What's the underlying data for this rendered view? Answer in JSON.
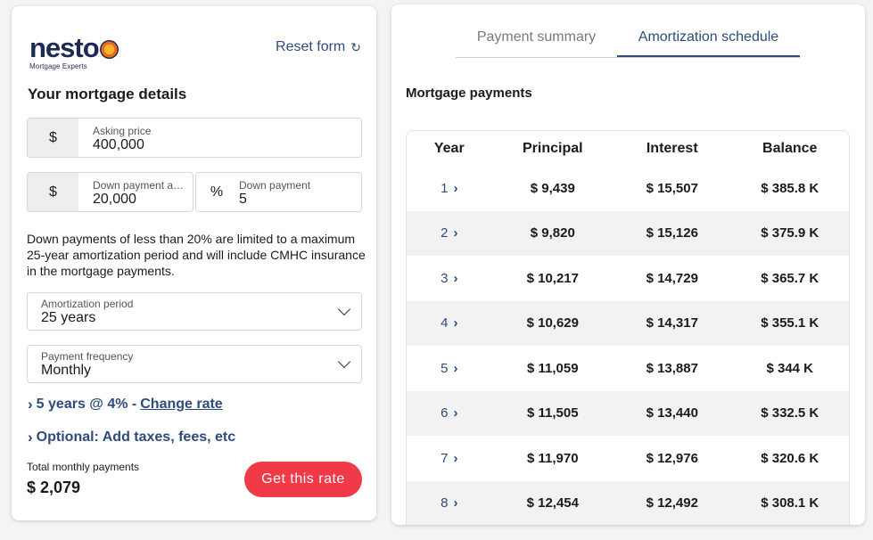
{
  "brand": {
    "name": "nesto",
    "tagline": "Mortgage Experts",
    "accent": "#2f4b7c",
    "cta_color": "#f03a47"
  },
  "form": {
    "reset_label": "Reset form",
    "title": "Your mortgage details",
    "asking_price": {
      "prefix": "$",
      "label": "Asking price",
      "value": "400,000"
    },
    "down_payment_amount": {
      "prefix": "$",
      "label": "Down payment amount",
      "value": "20,000"
    },
    "down_payment_pct": {
      "prefix": "%",
      "label": "Down payment",
      "value": "5"
    },
    "note": "Down payments of less than 20% are limited to a maximum 25-year amortization period and will include CMHC insurance in the mortgage payments.",
    "amortization": {
      "label": "Amortization period",
      "value": "25 years"
    },
    "frequency": {
      "label": "Payment frequency",
      "value": "Monthly"
    },
    "rate_text": "5 years @ 4% -",
    "change_rate": "Change rate",
    "optional_text": "Optional: Add taxes, fees, etc",
    "total_label": "Total monthly payments",
    "total_value": "$ 2,079",
    "cta_label": "Get this rate"
  },
  "tabs": [
    {
      "label": "Payment summary",
      "active": false
    },
    {
      "label": "Amortization schedule",
      "active": true
    }
  ],
  "schedule": {
    "title": "Mortgage payments",
    "headers": [
      "Year",
      "Principal",
      "Interest",
      "Balance"
    ],
    "rows": [
      {
        "year": "1",
        "principal": "$ 9,439",
        "interest": "$ 15,507",
        "balance": "$ 385.8 K"
      },
      {
        "year": "2",
        "principal": "$ 9,820",
        "interest": "$ 15,126",
        "balance": "$ 375.9 K"
      },
      {
        "year": "3",
        "principal": "$ 10,217",
        "interest": "$ 14,729",
        "balance": "$ 365.7 K"
      },
      {
        "year": "4",
        "principal": "$ 10,629",
        "interest": "$ 14,317",
        "balance": "$ 355.1 K"
      },
      {
        "year": "5",
        "principal": "$ 11,059",
        "interest": "$ 13,887",
        "balance": "$ 344 K"
      },
      {
        "year": "6",
        "principal": "$ 11,505",
        "interest": "$ 13,440",
        "balance": "$ 332.5 K"
      },
      {
        "year": "7",
        "principal": "$ 11,970",
        "interest": "$ 12,976",
        "balance": "$ 320.6 K"
      },
      {
        "year": "8",
        "principal": "$ 12,454",
        "interest": "$ 12,492",
        "balance": "$ 308.1 K"
      }
    ]
  }
}
